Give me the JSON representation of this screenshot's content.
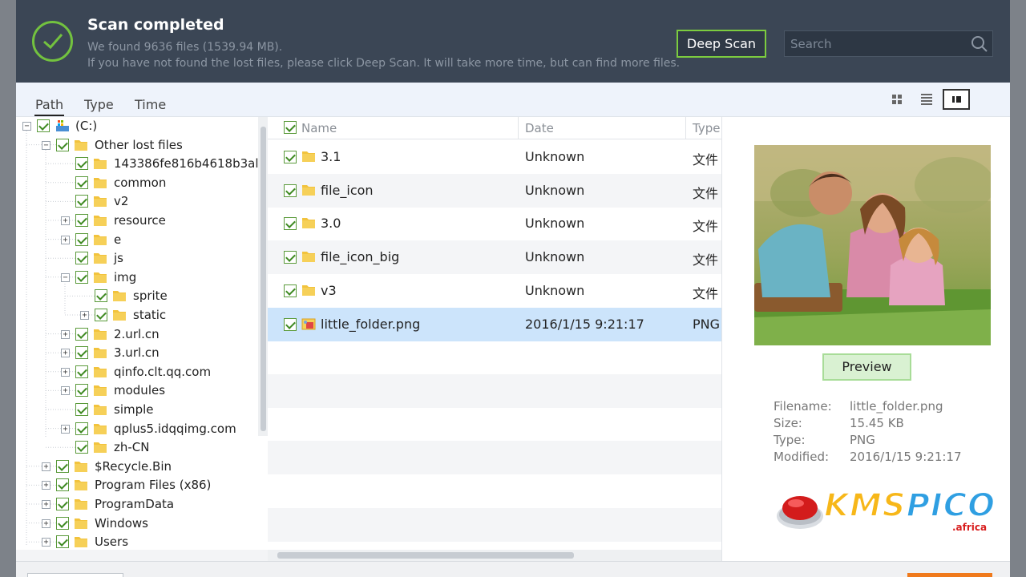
{
  "header": {
    "title": "Scan completed",
    "found_line": "We found 9636 files (1539.94 MB).",
    "hint_line": "If you have not found the lost files, please click Deep Scan. It will take more time, but can find more files.",
    "deep_scan_label": "Deep Scan",
    "search_placeholder": "Search"
  },
  "tabs": [
    "Path",
    "Type",
    "Time"
  ],
  "view_modes": [
    "thumbnail-view",
    "list-view",
    "detail-view"
  ],
  "tree": [
    {
      "label": "(C:)",
      "kind": "drive",
      "expander": "−"
    },
    {
      "label": "Other lost files",
      "kind": "folder",
      "expander": "−"
    },
    {
      "label": "143386fe816b4618b3al",
      "kind": "folder",
      "expander": ""
    },
    {
      "label": "common",
      "kind": "folder",
      "expander": ""
    },
    {
      "label": "v2",
      "kind": "folder",
      "expander": ""
    },
    {
      "label": "resource",
      "kind": "folder",
      "expander": "+"
    },
    {
      "label": "e",
      "kind": "folder",
      "expander": "+"
    },
    {
      "label": "js",
      "kind": "folder",
      "expander": ""
    },
    {
      "label": "img",
      "kind": "folder",
      "expander": "−"
    },
    {
      "label": "sprite",
      "kind": "folder",
      "expander": ""
    },
    {
      "label": "static",
      "kind": "folder",
      "expander": "+"
    },
    {
      "label": "2.url.cn",
      "kind": "folder",
      "expander": "+"
    },
    {
      "label": "3.url.cn",
      "kind": "folder",
      "expander": "+"
    },
    {
      "label": "qinfo.clt.qq.com",
      "kind": "folder",
      "expander": "+"
    },
    {
      "label": "modules",
      "kind": "folder",
      "expander": "+"
    },
    {
      "label": "simple",
      "kind": "folder",
      "expander": ""
    },
    {
      "label": "qplus5.idqqimg.com",
      "kind": "folder",
      "expander": "+"
    },
    {
      "label": "zh-CN",
      "kind": "folder",
      "expander": ""
    },
    {
      "label": "$Recycle.Bin",
      "kind": "folder",
      "expander": "+"
    },
    {
      "label": "Program Files (x86)",
      "kind": "folder",
      "expander": "+"
    },
    {
      "label": "ProgramData",
      "kind": "folder",
      "expander": "+"
    },
    {
      "label": "Windows",
      "kind": "folder",
      "expander": "+"
    },
    {
      "label": "Users",
      "kind": "folder",
      "expander": "+"
    }
  ],
  "list": {
    "columns": [
      "Name",
      "Date",
      "Type"
    ],
    "rows": [
      {
        "name": "3.1",
        "date": "Unknown",
        "type": "文件",
        "icon": "folder-icon",
        "selected": false
      },
      {
        "name": "file_icon",
        "date": "Unknown",
        "type": "文件",
        "icon": "folder-icon",
        "selected": false
      },
      {
        "name": "3.0",
        "date": "Unknown",
        "type": "文件",
        "icon": "folder-icon",
        "selected": false
      },
      {
        "name": "file_icon_big",
        "date": "Unknown",
        "type": "文件",
        "icon": "folder-icon",
        "selected": false
      },
      {
        "name": "v3",
        "date": "Unknown",
        "type": "文件",
        "icon": "folder-icon",
        "selected": false
      },
      {
        "name": "little_folder.png",
        "date": "2016/1/15 9:21:17",
        "type": "PNG",
        "icon": "image-file-icon",
        "selected": true
      }
    ]
  },
  "preview": {
    "button_label": "Preview",
    "meta": [
      {
        "key": "Filename:",
        "value": "little_folder.png"
      },
      {
        "key": "Size:",
        "value": "15.45 KB"
      },
      {
        "key": "Type:",
        "value": "PNG"
      },
      {
        "key": "Modified:",
        "value": "2016/1/15 9:21:17"
      }
    ]
  },
  "watermark": {
    "text": "KMSPICO",
    "sub": ".africa"
  },
  "colors": {
    "header_bg": "#3b4655",
    "accent_green": "#73c23f",
    "selection": "#cce4fb",
    "folder_yellow": "#f2c33d"
  }
}
